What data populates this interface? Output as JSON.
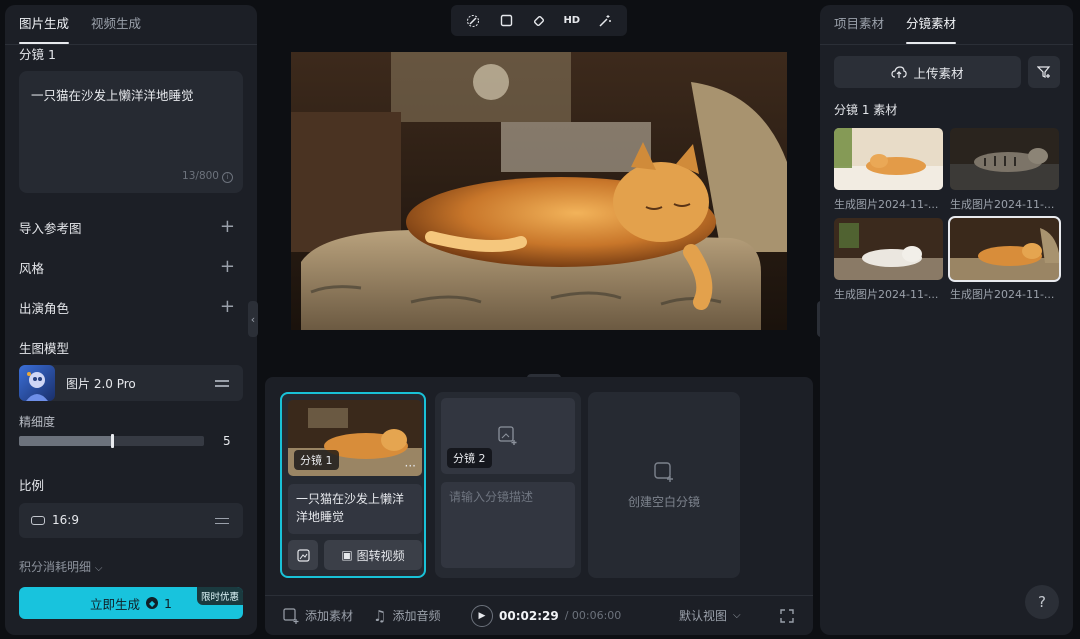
{
  "left_tabs": [
    "图片生成",
    "视频生成"
  ],
  "shot_label": "分镜 1",
  "prompt": {
    "text": "一只猫在沙发上懒洋洋地睡觉",
    "counter": "13/800"
  },
  "sections": {
    "reference": "导入参考图",
    "style": "风格",
    "cast": "出演角色",
    "model_title": "生图模型"
  },
  "model": {
    "name": "图片 2.0 Pro"
  },
  "detail": {
    "label": "精细度",
    "value": "5",
    "fraction": 0.5
  },
  "ratio": {
    "label": "比例",
    "value": "16:9"
  },
  "credits_detail": "积分消耗明细",
  "generate": {
    "label": "立即生成",
    "cost": "1",
    "promo": "限时优惠"
  },
  "toolbar": {
    "hd_label": "HD"
  },
  "storyboard": {
    "shots": [
      {
        "tag": "分镜 1",
        "desc": "一只猫在沙发上懒洋洋地睡觉",
        "action": "图转视频"
      },
      {
        "tag": "分镜 2",
        "desc_placeholder": "请输入分镜描述"
      }
    ],
    "create_blank": "创建空白分镜"
  },
  "timeline_bar": {
    "add_asset": "添加素材",
    "add_audio": "添加音频",
    "current_time": "00:02:29",
    "total_time": "/ 00:06:00",
    "view": "默认视图"
  },
  "right_tabs": [
    "项目素材",
    "分镜素材"
  ],
  "upload_label": "上传素材",
  "shot_assets_title": "分镜 1 素材",
  "assets": [
    {
      "caption": "生成图片2024-11-..."
    },
    {
      "caption": "生成图片2024-11-..."
    },
    {
      "caption": "生成图片2024-11-..."
    },
    {
      "caption": "生成图片2024-11-..."
    }
  ],
  "help": "?",
  "colors": {
    "accent": "#18c3dd",
    "panel": "#1c1f26",
    "background": "#0d0f13"
  }
}
